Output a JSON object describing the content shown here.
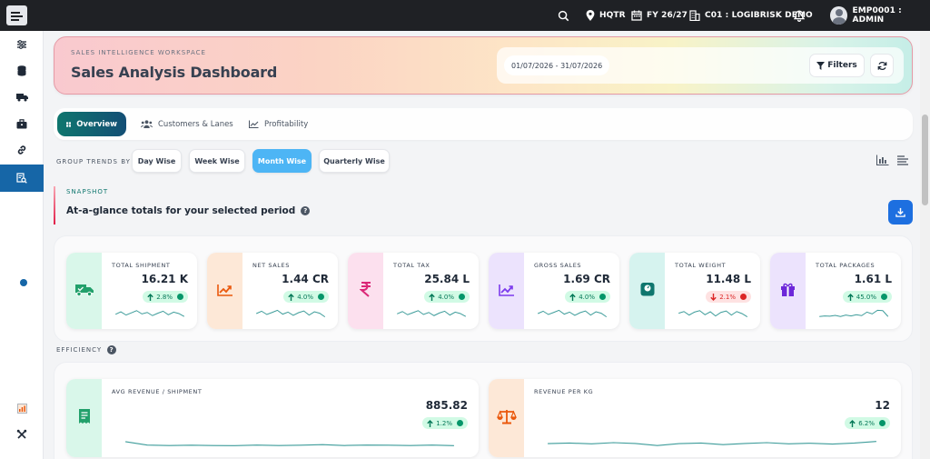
{
  "topbar": {
    "location": "HQTR",
    "fiscal_year": "FY 26/27",
    "company": "C01 : LOGIBRISK DEMO",
    "user": "EMP0001 : ADMIN"
  },
  "header": {
    "eyebrow": "SALES INTELLIGENCE WORKSPACE",
    "title": "Sales Analysis Dashboard",
    "date_range": "01/07/2026 - 31/07/2026",
    "filters_label": "Filters"
  },
  "tabs": [
    {
      "label": "Overview",
      "active": true
    },
    {
      "label": "Customers & Lanes",
      "active": false
    },
    {
      "label": "Profitability",
      "active": false
    }
  ],
  "group_trends": {
    "label": "GROUP TRENDS BY",
    "options": [
      {
        "label": "Day Wise",
        "active": false
      },
      {
        "label": "Week Wise",
        "active": false
      },
      {
        "label": "Month Wise",
        "active": true
      },
      {
        "label": "Quarterly Wise",
        "active": false
      }
    ]
  },
  "snapshot": {
    "eyebrow": "SNAPSHOT",
    "title": "At-a-glance totals for your selected period"
  },
  "kpis": [
    {
      "label": "TOTAL SHIPMENT",
      "value": "16.21 K",
      "change": "2.8%",
      "trend": "up",
      "icon": "truck-icon",
      "accent": "#22a06b",
      "tint": "#d9f7ea",
      "spark": [
        0.45,
        0.62,
        0.4,
        0.55,
        0.7,
        0.48,
        0.58,
        0.36,
        0.52,
        0.66,
        0.42,
        0.6,
        0.5,
        0.3
      ]
    },
    {
      "label": "NET SALES",
      "value": "1.44 CR",
      "change": "4.0%",
      "trend": "up",
      "icon": "chart-up-icon",
      "accent": "#ea580c",
      "tint": "#fde8d7",
      "spark": [
        0.5,
        0.66,
        0.44,
        0.58,
        0.72,
        0.46,
        0.6,
        0.38,
        0.56,
        0.68,
        0.4,
        0.62,
        0.52,
        0.28
      ]
    },
    {
      "label": "TOTAL TAX",
      "value": "25.84 L",
      "change": "4.0%",
      "trend": "up",
      "icon": "rupee-icon",
      "accent": "#db2777",
      "tint": "#fce0ee",
      "spark": [
        0.48,
        0.64,
        0.42,
        0.56,
        0.7,
        0.44,
        0.58,
        0.36,
        0.54,
        0.66,
        0.4,
        0.6,
        0.5,
        0.3
      ]
    },
    {
      "label": "GROSS SALES",
      "value": "1.69 CR",
      "change": "4.0%",
      "trend": "up",
      "icon": "chart-up-icon",
      "accent": "#7c3aed",
      "tint": "#ece3fd",
      "spark": [
        0.5,
        0.66,
        0.44,
        0.58,
        0.72,
        0.46,
        0.6,
        0.38,
        0.56,
        0.68,
        0.4,
        0.62,
        0.52,
        0.28
      ]
    },
    {
      "label": "TOTAL WEIGHT",
      "value": "11.48 L",
      "change": "2.1%",
      "trend": "down",
      "icon": "weight-icon",
      "accent": "#0f766e",
      "tint": "#d6f3ef",
      "spark": [
        0.52,
        0.64,
        0.4,
        0.6,
        0.7,
        0.42,
        0.62,
        0.34,
        0.58,
        0.68,
        0.4,
        0.64,
        0.5,
        0.28
      ]
    },
    {
      "label": "TOTAL PACKAGES",
      "value": "1.61 L",
      "change": "45.0%",
      "trend": "up",
      "icon": "gift-icon",
      "accent": "#6d28d9",
      "tint": "#ece3fd",
      "spark": [
        0.3,
        0.34,
        0.32,
        0.38,
        0.3,
        0.4,
        0.34,
        0.42,
        0.36,
        0.6,
        0.48,
        0.72,
        0.7,
        0.3
      ]
    }
  ],
  "efficiency": {
    "label": "EFFICIENCY",
    "cards": [
      {
        "label": "AVG REVENUE / SHIPMENT",
        "value": "885.82",
        "change": "1.2%",
        "trend": "up",
        "icon": "receipt-icon",
        "accent": "#22a06b",
        "tint": "#d9f7ea",
        "spark": [
          0.55,
          0.38,
          0.36,
          0.37,
          0.36,
          0.35,
          0.38,
          0.36,
          0.37,
          0.4,
          0.36,
          0.38,
          0.37,
          0.36,
          0.38,
          0.35
        ]
      },
      {
        "label": "REVENUE PER KG",
        "value": "12",
        "change": "6.2%",
        "trend": "up",
        "icon": "scale-icon",
        "accent": "#ea580c",
        "tint": "#fde8d7",
        "spark": [
          0.45,
          0.48,
          0.44,
          0.5,
          0.46,
          0.36,
          0.45,
          0.48,
          0.4,
          0.46,
          0.5,
          0.44,
          0.47,
          0.43,
          0.48,
          0.56
        ]
      }
    ]
  }
}
